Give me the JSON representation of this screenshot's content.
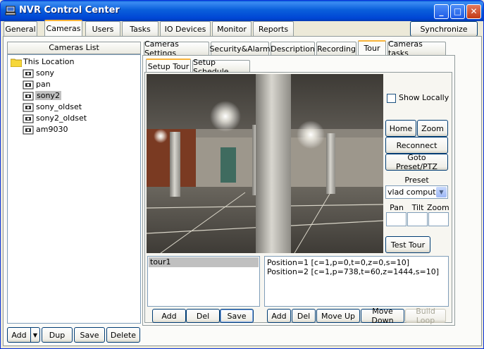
{
  "window": {
    "title": "NVR Control Center",
    "controls": {
      "minimize": "_",
      "maximize": "□",
      "close": "✕"
    }
  },
  "top_tabs": [
    {
      "label": "General"
    },
    {
      "label": "Cameras"
    },
    {
      "label": "Users"
    },
    {
      "label": "Tasks"
    },
    {
      "label": "IO Devices"
    },
    {
      "label": "Monitor"
    },
    {
      "label": "Reports"
    }
  ],
  "synchronize_label": "Synchronize",
  "cameras_list": {
    "header": "Cameras List",
    "root": "This Location",
    "items": [
      "sony",
      "pan",
      "sony2",
      "sony_oldset",
      "sony2_oldset",
      "am9030"
    ],
    "selected": "sony2"
  },
  "left_buttons": {
    "add": "Add",
    "add_arrow": "▼",
    "dup": "Dup",
    "save": "Save",
    "delete": "Delete"
  },
  "camera_tabs": [
    {
      "label": "Cameras Settings"
    },
    {
      "label": "Security&Alarm"
    },
    {
      "label": "Description"
    },
    {
      "label": "Recording"
    },
    {
      "label": "Tour"
    },
    {
      "label": "Cameras tasks"
    }
  ],
  "tour_subtabs": [
    {
      "label": "Setup Tour"
    },
    {
      "label": "Setup Schedule"
    }
  ],
  "controls": {
    "show_locally": "Show Locally",
    "home": "Home",
    "zoom": "Zoom",
    "reconnect": "Reconnect",
    "goto_preset": "Goto Preset/PTZ",
    "preset_label": "Preset",
    "preset_value": "vlad computer",
    "pan_label": "Pan",
    "tilt_label": "Tilt",
    "zoom_label": "Zoom",
    "test_tour": "Test Tour"
  },
  "tours": {
    "items": [
      "tour1"
    ],
    "selected": "tour1",
    "buttons": {
      "add": "Add",
      "del": "Del",
      "save": "Save"
    }
  },
  "positions": {
    "items": [
      "Position=1  [c=1,p=0,t=0,z=0,s=10]",
      "Position=2  [c=1,p=738,t=60,z=1444,s=10]"
    ],
    "buttons": {
      "add": "Add",
      "del": "Del",
      "move_up": "Move Up",
      "move_down": "Move Down",
      "build_loop": "Build Loop"
    }
  },
  "colors": {
    "titlebar": "#0a5fdb",
    "selection": "#c0c0c0",
    "tab_accent": "#f8b33a",
    "window_bg": "#ece9d8"
  }
}
